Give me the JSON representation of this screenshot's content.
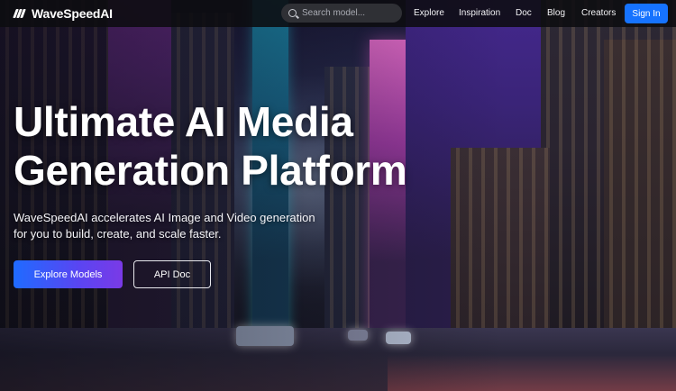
{
  "brand": {
    "name": "WaveSpeedAI",
    "icon": "wave-logo-icon"
  },
  "search": {
    "placeholder": "Search model...",
    "value": ""
  },
  "nav": {
    "links": [
      "Explore",
      "Inspiration",
      "Doc",
      "Blog",
      "Creators"
    ],
    "signin_label": "Sign In"
  },
  "hero": {
    "title_line1": "Ultimate AI Media",
    "title_line2": "Generation Platform",
    "subtitle_line1": "WaveSpeedAI accelerates AI Image and Video generation",
    "subtitle_line2": "for you to build, create, and scale faster.",
    "primary_button": "Explore Models",
    "secondary_button": "API Doc"
  },
  "colors": {
    "accent": "#1673ff",
    "primary_gradient_start": "#1f6bff",
    "primary_gradient_end": "#7a3ae6",
    "nav_background": "#0c0c10"
  }
}
